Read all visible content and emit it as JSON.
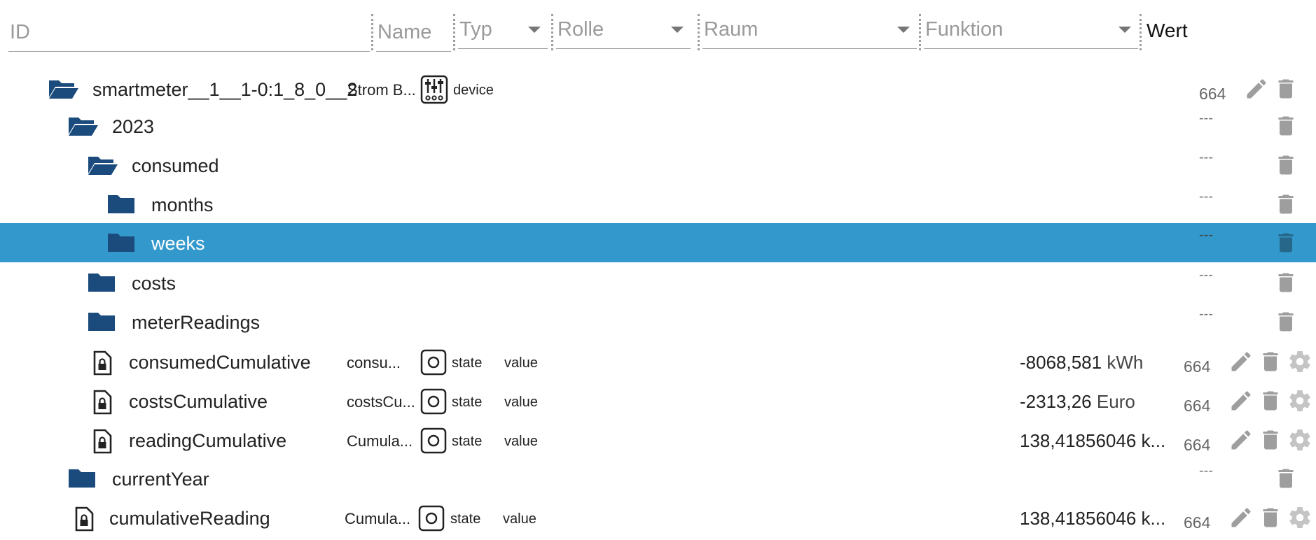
{
  "header": {
    "id_placeholder": "ID",
    "name_placeholder": "Name",
    "typ_placeholder": "Typ",
    "rolle_placeholder": "Rolle",
    "raum_placeholder": "Raum",
    "funktion_placeholder": "Funktion",
    "wert_label": "Wert"
  },
  "rows": [
    {
      "id": "smartmeter__1__1-0:1_8_0__2",
      "name": "Strom B...",
      "type": "device",
      "acl": "664"
    },
    {
      "id": "2023",
      "dash": "---"
    },
    {
      "id": "consumed",
      "dash": "---"
    },
    {
      "id": "months",
      "dash": "---"
    },
    {
      "id": "weeks",
      "dash": "---",
      "selected": true
    },
    {
      "id": "costs",
      "dash": "---"
    },
    {
      "id": "meterReadings",
      "dash": "---"
    },
    {
      "id": "consumedCumulative",
      "name": "consu...",
      "type": "state",
      "role": "value",
      "value": "-8068,581",
      "unit": "kWh",
      "acl": "664"
    },
    {
      "id": "costsCumulative",
      "name": "costsCu...",
      "type": "state",
      "role": "value",
      "value": "-2313,26",
      "unit": "Euro",
      "acl": "664"
    },
    {
      "id": "readingCumulative",
      "name": "Cumula...",
      "type": "state",
      "role": "value",
      "value": "138,41856046 k...",
      "acl": "664"
    },
    {
      "id": "currentYear",
      "dash": "---"
    },
    {
      "id": "cumulativeReading",
      "name": "Cumula...",
      "type": "state",
      "role": "value",
      "value": "138,41856046 k...",
      "acl": "664"
    }
  ],
  "colors": {
    "folder": "#1b4b7d",
    "selected_row": "#3399cc",
    "action_icon": "#9e9e9e"
  },
  "icons": {
    "open_folder": "folder-open-icon",
    "closed_folder": "folder-icon",
    "state_file": "file-lock-icon",
    "device": "device-sliders-icon",
    "state": "state-circle-icon",
    "edit": "pencil-icon",
    "delete": "trash-icon",
    "settings": "gear-icon"
  }
}
